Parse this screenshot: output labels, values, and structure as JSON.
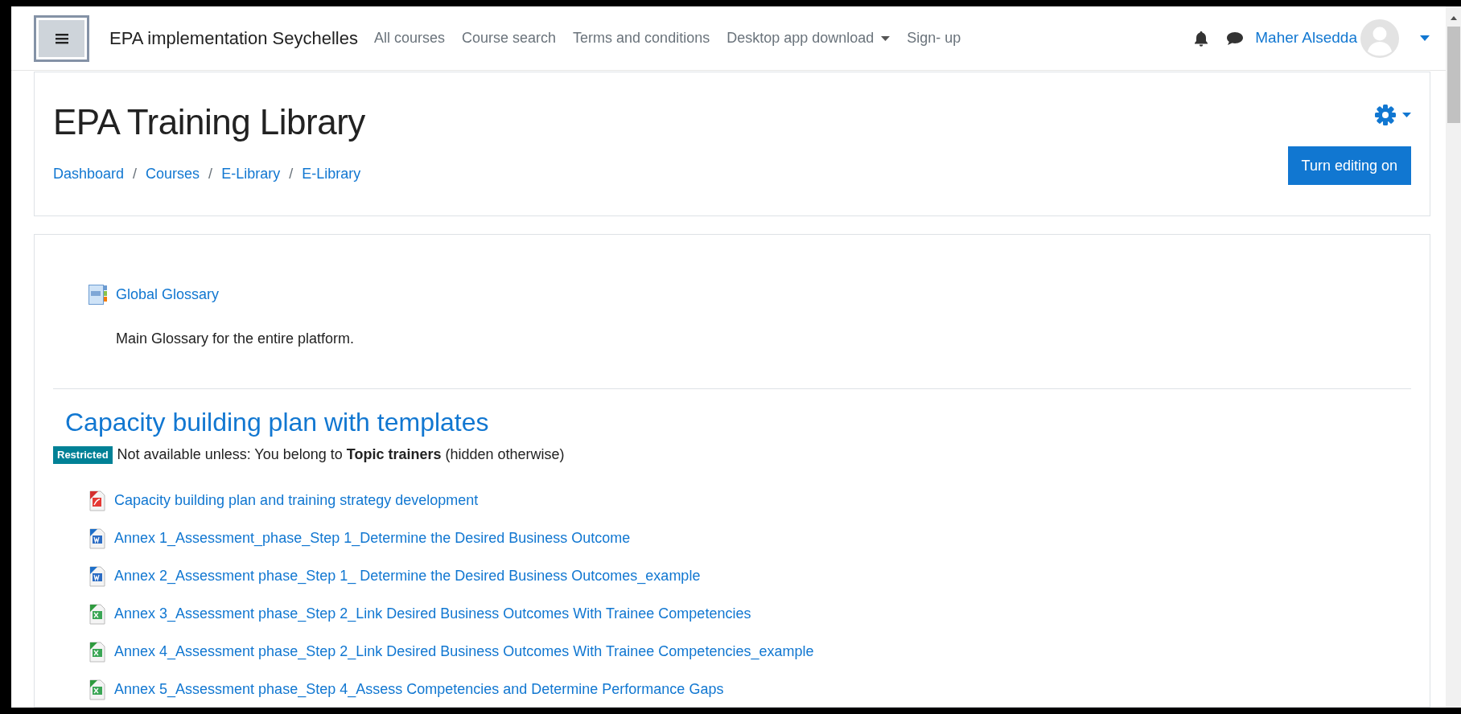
{
  "navbar": {
    "site_name": "EPA implementation Seychelles",
    "links": [
      {
        "label": "All courses",
        "has_dropdown": false
      },
      {
        "label": "Course search",
        "has_dropdown": false
      },
      {
        "label": "Terms and conditions",
        "has_dropdown": false
      },
      {
        "label": "Desktop app download",
        "has_dropdown": true
      },
      {
        "label": "Sign- up",
        "has_dropdown": false
      }
    ],
    "user_name": "Maher Alsedda"
  },
  "header": {
    "title": "EPA Training Library",
    "breadcrumb": [
      "Dashboard",
      "Courses",
      "E-Library",
      "E-Library"
    ],
    "breadcrumb_separator": "/",
    "button": "Turn editing on"
  },
  "glossary": {
    "title": "Global Glossary",
    "description": "Main Glossary for the entire platform."
  },
  "section": {
    "title": "Capacity building plan with templates",
    "badge": "Restricted",
    "restriction": "Not available unless: You belong to **Topic trainers** (hidden otherwise)"
  },
  "files": [
    {
      "kind": "pdf",
      "title": "Capacity building plan and training strategy development"
    },
    {
      "kind": "word",
      "title": "Annex 1_Assessment_phase_Step 1_Determine the Desired Business Outcome"
    },
    {
      "kind": "word",
      "title": "Annex 2_Assessment phase_Step 1_ Determine the Desired Business Outcomes_example"
    },
    {
      "kind": "excel",
      "title": "Annex 3_Assessment phase_Step 2_Link Desired Business Outcomes With Trainee Competencies"
    },
    {
      "kind": "excel",
      "title": "Annex 4_Assessment phase_Step 2_Link Desired Business Outcomes With Trainee Competencies_example"
    },
    {
      "kind": "excel",
      "title": "Annex 5_Assessment phase_Step 4_Assess Competencies and Determine Performance Gaps"
    }
  ]
}
